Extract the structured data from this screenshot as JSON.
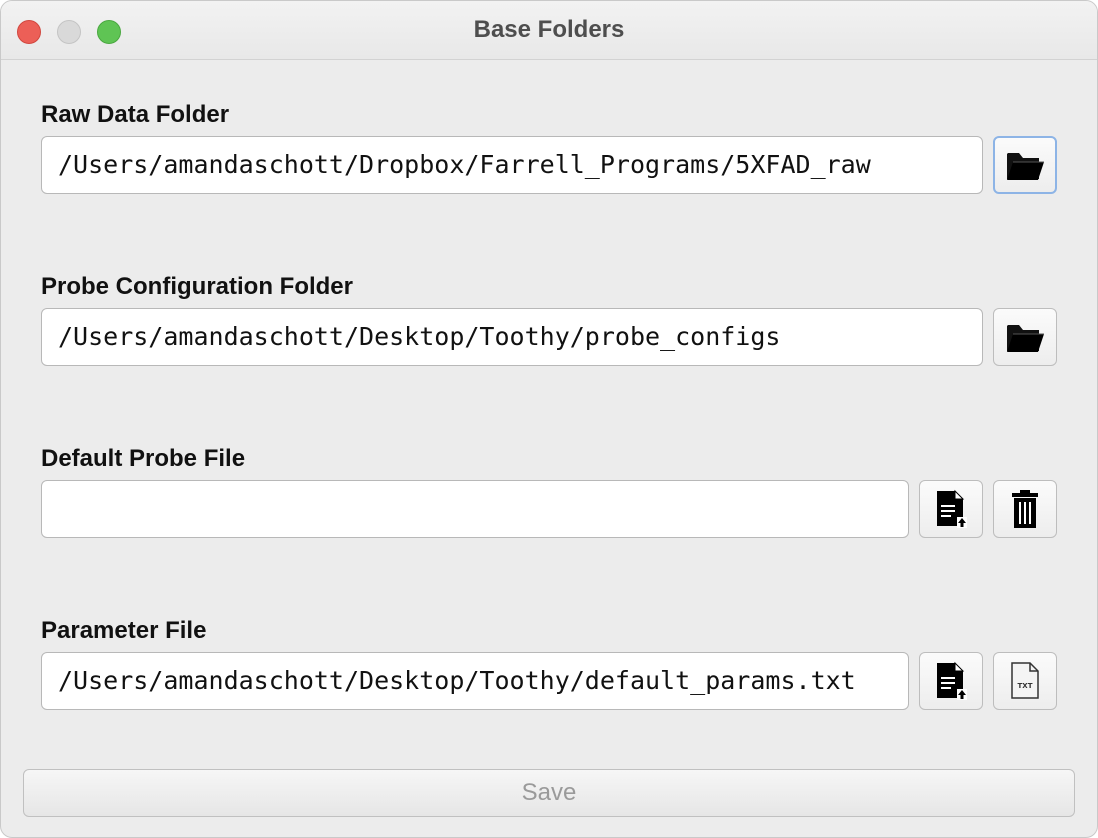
{
  "window": {
    "title": "Base Folders"
  },
  "sections": {
    "raw_data": {
      "label": "Raw Data Folder",
      "value": "/Users/amandaschott/Dropbox/Farrell_Programs/5XFAD_raw"
    },
    "probe_config": {
      "label": "Probe Configuration Folder",
      "value": "/Users/amandaschott/Desktop/Toothy/probe_configs"
    },
    "default_probe": {
      "label": "Default Probe File",
      "value": ""
    },
    "param_file": {
      "label": "Parameter File",
      "value": "/Users/amandaschott/Desktop/Toothy/default_params.txt"
    }
  },
  "icons": {
    "folder": "folder-open-icon",
    "load_file": "file-upload-icon",
    "trash": "trash-icon",
    "txt_file": "txt-file-icon",
    "txt_file_label": "TXT"
  },
  "footer": {
    "save_label": "Save"
  },
  "colors": {
    "close": "#ec5f57",
    "minimize": "#d9d9d9",
    "zoom": "#5fc454",
    "focus_ring": "#8db4e6"
  }
}
